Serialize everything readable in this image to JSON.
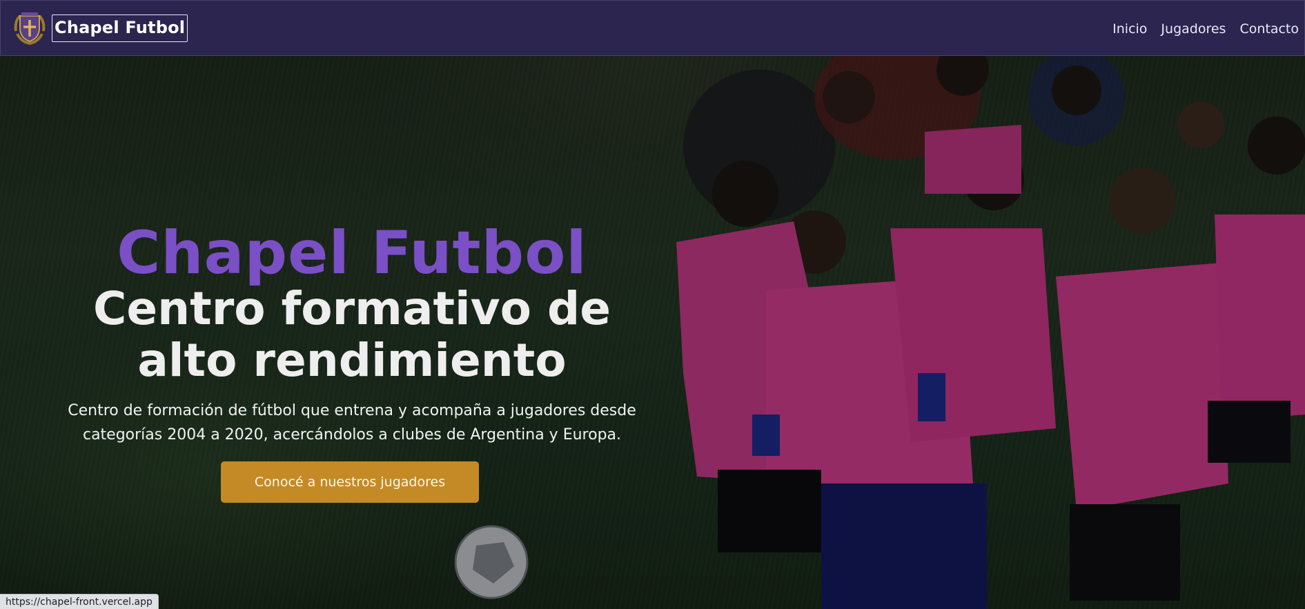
{
  "header": {
    "brand_name": "Chapel Futbol",
    "logo_icon": "shield-cross-crest-icon",
    "nav_links": [
      {
        "label": "Inicio"
      },
      {
        "label": "Jugadores"
      },
      {
        "label": "Contacto"
      }
    ]
  },
  "hero": {
    "title": "Chapel Futbol",
    "subtitle_line1": "Centro formativo de",
    "subtitle_line2": "alto rendimiento",
    "description_line1": "Centro de formación de fútbol que entrena y acompaña a jugadores desde",
    "description_line2": "categorías 2004 a 2020, acercándolos a clubes de Argentina y Europa.",
    "cta_label": "Conocé a nuestros jugadores",
    "background": "photo-youth-football-team-huddle-with-coach-on-grass-field"
  },
  "status_bar": {
    "url": "https://chapel-front.vercel.app"
  },
  "colors": {
    "nav_bg": "#2b2550",
    "accent_purple": "#7b4fc5",
    "cta_gold": "#c48a25"
  }
}
